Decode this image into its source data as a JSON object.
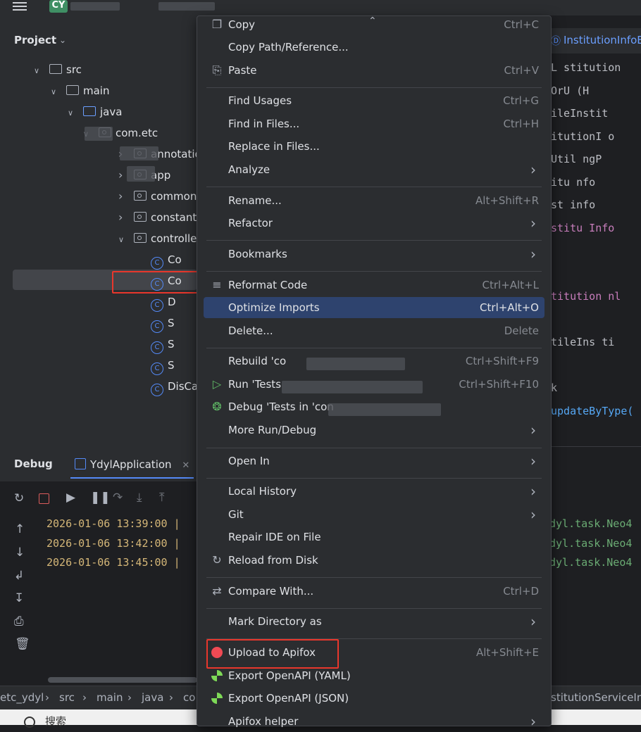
{
  "topbar": {
    "project_badge": "CY"
  },
  "project_panel": {
    "title": "Project",
    "tree": [
      {
        "label": "src",
        "level": 0,
        "expanded": true,
        "icon": "folder-icon"
      },
      {
        "label": "main",
        "level": 1,
        "expanded": true,
        "icon": "folder-icon"
      },
      {
        "label": "java",
        "level": 2,
        "expanded": true,
        "icon": "source-folder-icon"
      },
      {
        "label": "com.etc",
        "level": 3,
        "expanded": true,
        "icon": "package-icon"
      },
      {
        "label": "annotation",
        "level": 5,
        "expanded": false,
        "icon": "package-icon"
      },
      {
        "label": "app",
        "level": 5,
        "expanded": false,
        "icon": "package-icon"
      },
      {
        "label": "common",
        "level": 5,
        "expanded": false,
        "icon": "package-icon"
      },
      {
        "label": "constant",
        "level": 5,
        "expanded": false,
        "icon": "package-icon"
      },
      {
        "label": "controller",
        "level": 5,
        "expanded": true,
        "selected": true,
        "icon": "package-icon"
      },
      {
        "label": "Co",
        "level": 6,
        "icon": "class-icon"
      },
      {
        "label": "Co",
        "level": 6,
        "icon": "class-icon"
      },
      {
        "label": "D",
        "level": 6,
        "icon": "class-icon"
      },
      {
        "label": "S",
        "level": 6,
        "icon": "class-icon"
      },
      {
        "label": "S",
        "level": 6,
        "icon": "class-icon"
      },
      {
        "label": "S",
        "level": 6,
        "icon": "class-icon"
      },
      {
        "label": "DisCap",
        "level": 6,
        "icon": "class-icon"
      }
    ]
  },
  "editor": {
    "tab_label": "InstitutionInfoB",
    "lines": [
      "L  stitution",
      "OrU  (H",
      "ileInstit",
      "itutionI  o",
      "Util  ngP",
      "itu   nfo",
      "st     info",
      "stitu   Info",
      "",
      "",
      "titution  nl",
      "",
      "tileIns   ti",
      "",
      "k",
      "updateByType("
    ]
  },
  "debug": {
    "title": "Debug",
    "tab_label": "YdylApplication",
    "logs": [
      {
        "time": "2026-01-06 13:39:00 |",
        "tail": "dyl.task.Neo4"
      },
      {
        "time": "2026-01-06 13:42:00 |",
        "tail": "dyl.task.Neo4"
      },
      {
        "time": "2026-01-06 13:45:00 |",
        "tail": "dyl.task.Neo4"
      }
    ]
  },
  "statusbar": {
    "breadcrumbs": [
      "etc_ydyl",
      "src",
      "main",
      "java",
      "co"
    ],
    "right_text": "stitutionServiceIm",
    "search_text": "搜索"
  },
  "context_menu": {
    "items": [
      {
        "id": "copy",
        "label": "Copy",
        "shortcut": "Ctrl+C",
        "icon": "copy-icon"
      },
      {
        "id": "copy-path",
        "label": "Copy Path/Reference...",
        "shortcut": ""
      },
      {
        "id": "paste",
        "label": "Paste",
        "shortcut": "Ctrl+V",
        "icon": "paste-icon"
      },
      {
        "id": "find-usages",
        "label": "Find Usages",
        "shortcut": "Ctrl+G"
      },
      {
        "id": "find-in-files",
        "label": "Find in Files...",
        "shortcut": "Ctrl+H"
      },
      {
        "id": "replace-in-files",
        "label": "Replace in Files...",
        "shortcut": ""
      },
      {
        "id": "analyze",
        "label": "Analyze",
        "submenu": true
      },
      {
        "id": "rename",
        "label": "Rename...",
        "shortcut": "Alt+Shift+R"
      },
      {
        "id": "refactor",
        "label": "Refactor",
        "submenu": true
      },
      {
        "id": "bookmarks",
        "label": "Bookmarks",
        "submenu": true
      },
      {
        "id": "reformat-code",
        "label": "Reformat Code",
        "shortcut": "Ctrl+Alt+L",
        "icon": "reformat-icon"
      },
      {
        "id": "optimize-imports",
        "label": "Optimize Imports",
        "shortcut": "Ctrl+Alt+O",
        "active": true
      },
      {
        "id": "delete",
        "label": "Delete...",
        "shortcut": "Delete"
      },
      {
        "id": "rebuild",
        "label": "Rebuild 'co",
        "shortcut": "Ctrl+Shift+F9"
      },
      {
        "id": "run-tests",
        "label": "Run 'Tests",
        "shortcut": "Ctrl+Shift+F10",
        "icon": "run-icon"
      },
      {
        "id": "debug-tests",
        "label": "Debug 'Tests in 'con",
        "shortcut": "",
        "icon": "debug-icon"
      },
      {
        "id": "more-run-debug",
        "label": "More Run/Debug",
        "submenu": true
      },
      {
        "id": "open-in",
        "label": "Open In",
        "submenu": true
      },
      {
        "id": "local-history",
        "label": "Local History",
        "submenu": true
      },
      {
        "id": "git",
        "label": "Git",
        "submenu": true
      },
      {
        "id": "repair-ide",
        "label": "Repair IDE on File",
        "shortcut": ""
      },
      {
        "id": "reload-from-disk",
        "label": "Reload from Disk",
        "shortcut": "",
        "icon": "reload-icon"
      },
      {
        "id": "compare-with",
        "label": "Compare With...",
        "shortcut": "Ctrl+D",
        "icon": "compare-icon"
      },
      {
        "id": "mark-directory",
        "label": "Mark Directory as",
        "submenu": true
      },
      {
        "id": "upload-apifox",
        "label": "Upload to Apifox",
        "shortcut": "Alt+Shift+E",
        "icon": "apifox-icon"
      },
      {
        "id": "export-yaml",
        "label": "Export OpenAPI (YAML)",
        "shortcut": "",
        "icon": "export-icon"
      },
      {
        "id": "export-json",
        "label": "Export OpenAPI (JSON)",
        "shortcut": "",
        "icon": "export-icon"
      },
      {
        "id": "apifox-helper",
        "label": "Apifox helper",
        "submenu": true
      }
    ]
  },
  "colors": {
    "menu_bg": "#2b2d30",
    "active_item": "#2e436e",
    "highlight_box": "#e8372c",
    "log_time": "#d5b778",
    "apifox_brand": "#f04a54"
  }
}
